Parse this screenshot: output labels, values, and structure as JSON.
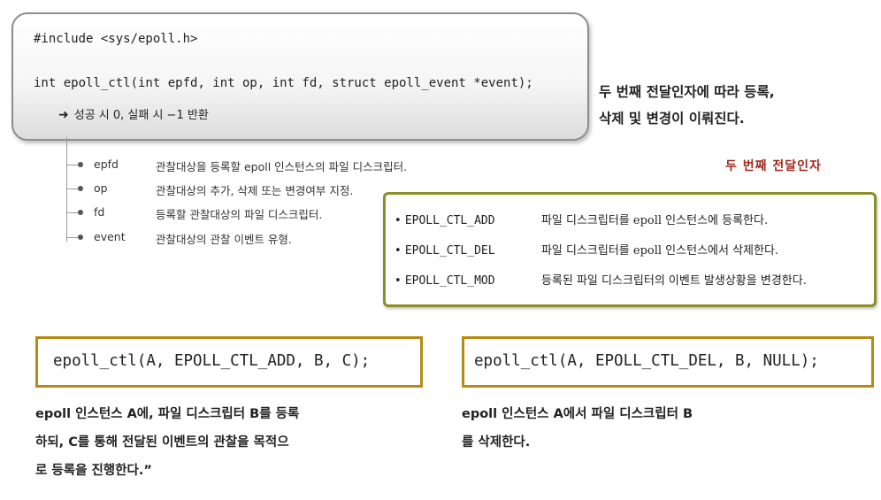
{
  "signature": {
    "include": "#include <sys/epoll.h>",
    "prototype": "int epoll_ctl(int epfd, int op, int fd, struct epoll_event *event);",
    "return_arrow": "➜",
    "return_text": "성공 시 0, 실패 시 −1 반환"
  },
  "note": {
    "line1": "두 번째 전달인자에 따라 등록,",
    "line2": "삭제 및 변경이 이뤄진다."
  },
  "params": [
    {
      "name": "epfd",
      "desc": "관찰대상을 등록할 epoll 인스턴스의 파일 디스크립터."
    },
    {
      "name": "op",
      "desc": "관찰대상의 추가, 삭제 또는 변경여부 지정."
    },
    {
      "name": "fd",
      "desc": "등록할 관찰대상의 파일 디스크립터."
    },
    {
      "name": "event",
      "desc": "관찰대상의 관찰 이벤트 유형."
    }
  ],
  "second_arg_label": "두 번째 전달인자",
  "constants": [
    {
      "name": "EPOLL_CTL_ADD",
      "desc": "파일 디스크립터를 epoll 인스턴스에 등록한다."
    },
    {
      "name": "EPOLL_CTL_DEL",
      "desc": "파일 디스크립터를 epoll 인스턴스에서 삭제한다."
    },
    {
      "name": "EPOLL_CTL_MOD",
      "desc": "등록된 파일 디스크립터의 이벤트 발생상황을 변경한다."
    }
  ],
  "constant_bullet": "•",
  "examples": [
    {
      "code": "epoll_ctl(A, EPOLL_CTL_ADD, B, C);",
      "lines": [
        "epoll 인스턴스 A에, 파일 디스크립터 B를 등록",
        "하되, C를 통해 전달된 이벤트의 관찰을 목적으",
        "로 등록을 진행한다.”"
      ]
    },
    {
      "code": "epoll_ctl(A, EPOLL_CTL_DEL, B, NULL);",
      "lines": [
        "epoll 인스턴스 A에서 파일 디스크립터 B",
        "를 삭제한다."
      ]
    }
  ],
  "colors": {
    "constants_border": "#8a8f2a",
    "example_border": "#b68a14",
    "second_arg_label": "#a1281a"
  }
}
